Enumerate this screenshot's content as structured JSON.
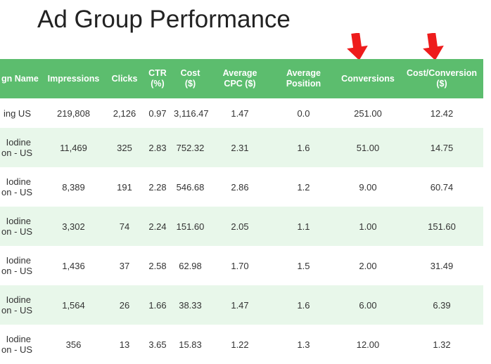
{
  "page": {
    "title": "Ad Group Performance"
  },
  "colors": {
    "header_bg": "#5cbd6e",
    "stripe_bg": "#e8f7ea",
    "arrow": "#ee1c1c"
  },
  "annotations": {
    "arrows": [
      {
        "icon": "down-arrow-icon",
        "points_to": "Conversions"
      },
      {
        "icon": "down-arrow-icon",
        "points_to": "Cost/Conversion ($)"
      }
    ]
  },
  "table": {
    "headers": [
      [
        "gn Name"
      ],
      [
        "Impressions"
      ],
      [
        "Clicks"
      ],
      [
        "CTR",
        "(%)"
      ],
      [
        "Cost",
        "($)"
      ],
      [
        "Average",
        "CPC ($)"
      ],
      [
        "Average",
        "Position"
      ],
      [
        "Conversions"
      ],
      [
        "Cost/Conversion",
        "($)"
      ]
    ],
    "rows": [
      {
        "name": [
          "ing US"
        ],
        "impressions": "219,808",
        "clicks": "2,126",
        "ctr": "0.97",
        "cost": "3,116.47",
        "avg_cpc": "1.47",
        "avg_position": "0.0",
        "conversions": "251.00",
        "cost_per_conversion": "12.42"
      },
      {
        "name": [
          "Iodine",
          "on - US"
        ],
        "impressions": "11,469",
        "clicks": "325",
        "ctr": "2.83",
        "cost": "752.32",
        "avg_cpc": "2.31",
        "avg_position": "1.6",
        "conversions": "51.00",
        "cost_per_conversion": "14.75"
      },
      {
        "name": [
          "Iodine",
          "on - US"
        ],
        "impressions": "8,389",
        "clicks": "191",
        "ctr": "2.28",
        "cost": "546.68",
        "avg_cpc": "2.86",
        "avg_position": "1.2",
        "conversions": "9.00",
        "cost_per_conversion": "60.74"
      },
      {
        "name": [
          "Iodine",
          "on - US"
        ],
        "impressions": "3,302",
        "clicks": "74",
        "ctr": "2.24",
        "cost": "151.60",
        "avg_cpc": "2.05",
        "avg_position": "1.1",
        "conversions": "1.00",
        "cost_per_conversion": "151.60"
      },
      {
        "name": [
          "Iodine",
          "on - US"
        ],
        "impressions": "1,436",
        "clicks": "37",
        "ctr": "2.58",
        "cost": "62.98",
        "avg_cpc": "1.70",
        "avg_position": "1.5",
        "conversions": "2.00",
        "cost_per_conversion": "31.49"
      },
      {
        "name": [
          "Iodine",
          "on - US"
        ],
        "impressions": "1,564",
        "clicks": "26",
        "ctr": "1.66",
        "cost": "38.33",
        "avg_cpc": "1.47",
        "avg_position": "1.6",
        "conversions": "6.00",
        "cost_per_conversion": "6.39"
      },
      {
        "name": [
          "Iodine",
          "on - US"
        ],
        "impressions": "356",
        "clicks": "13",
        "ctr": "3.65",
        "cost": "15.83",
        "avg_cpc": "1.22",
        "avg_position": "1.3",
        "conversions": "12.00",
        "cost_per_conversion": "1.32"
      }
    ]
  }
}
